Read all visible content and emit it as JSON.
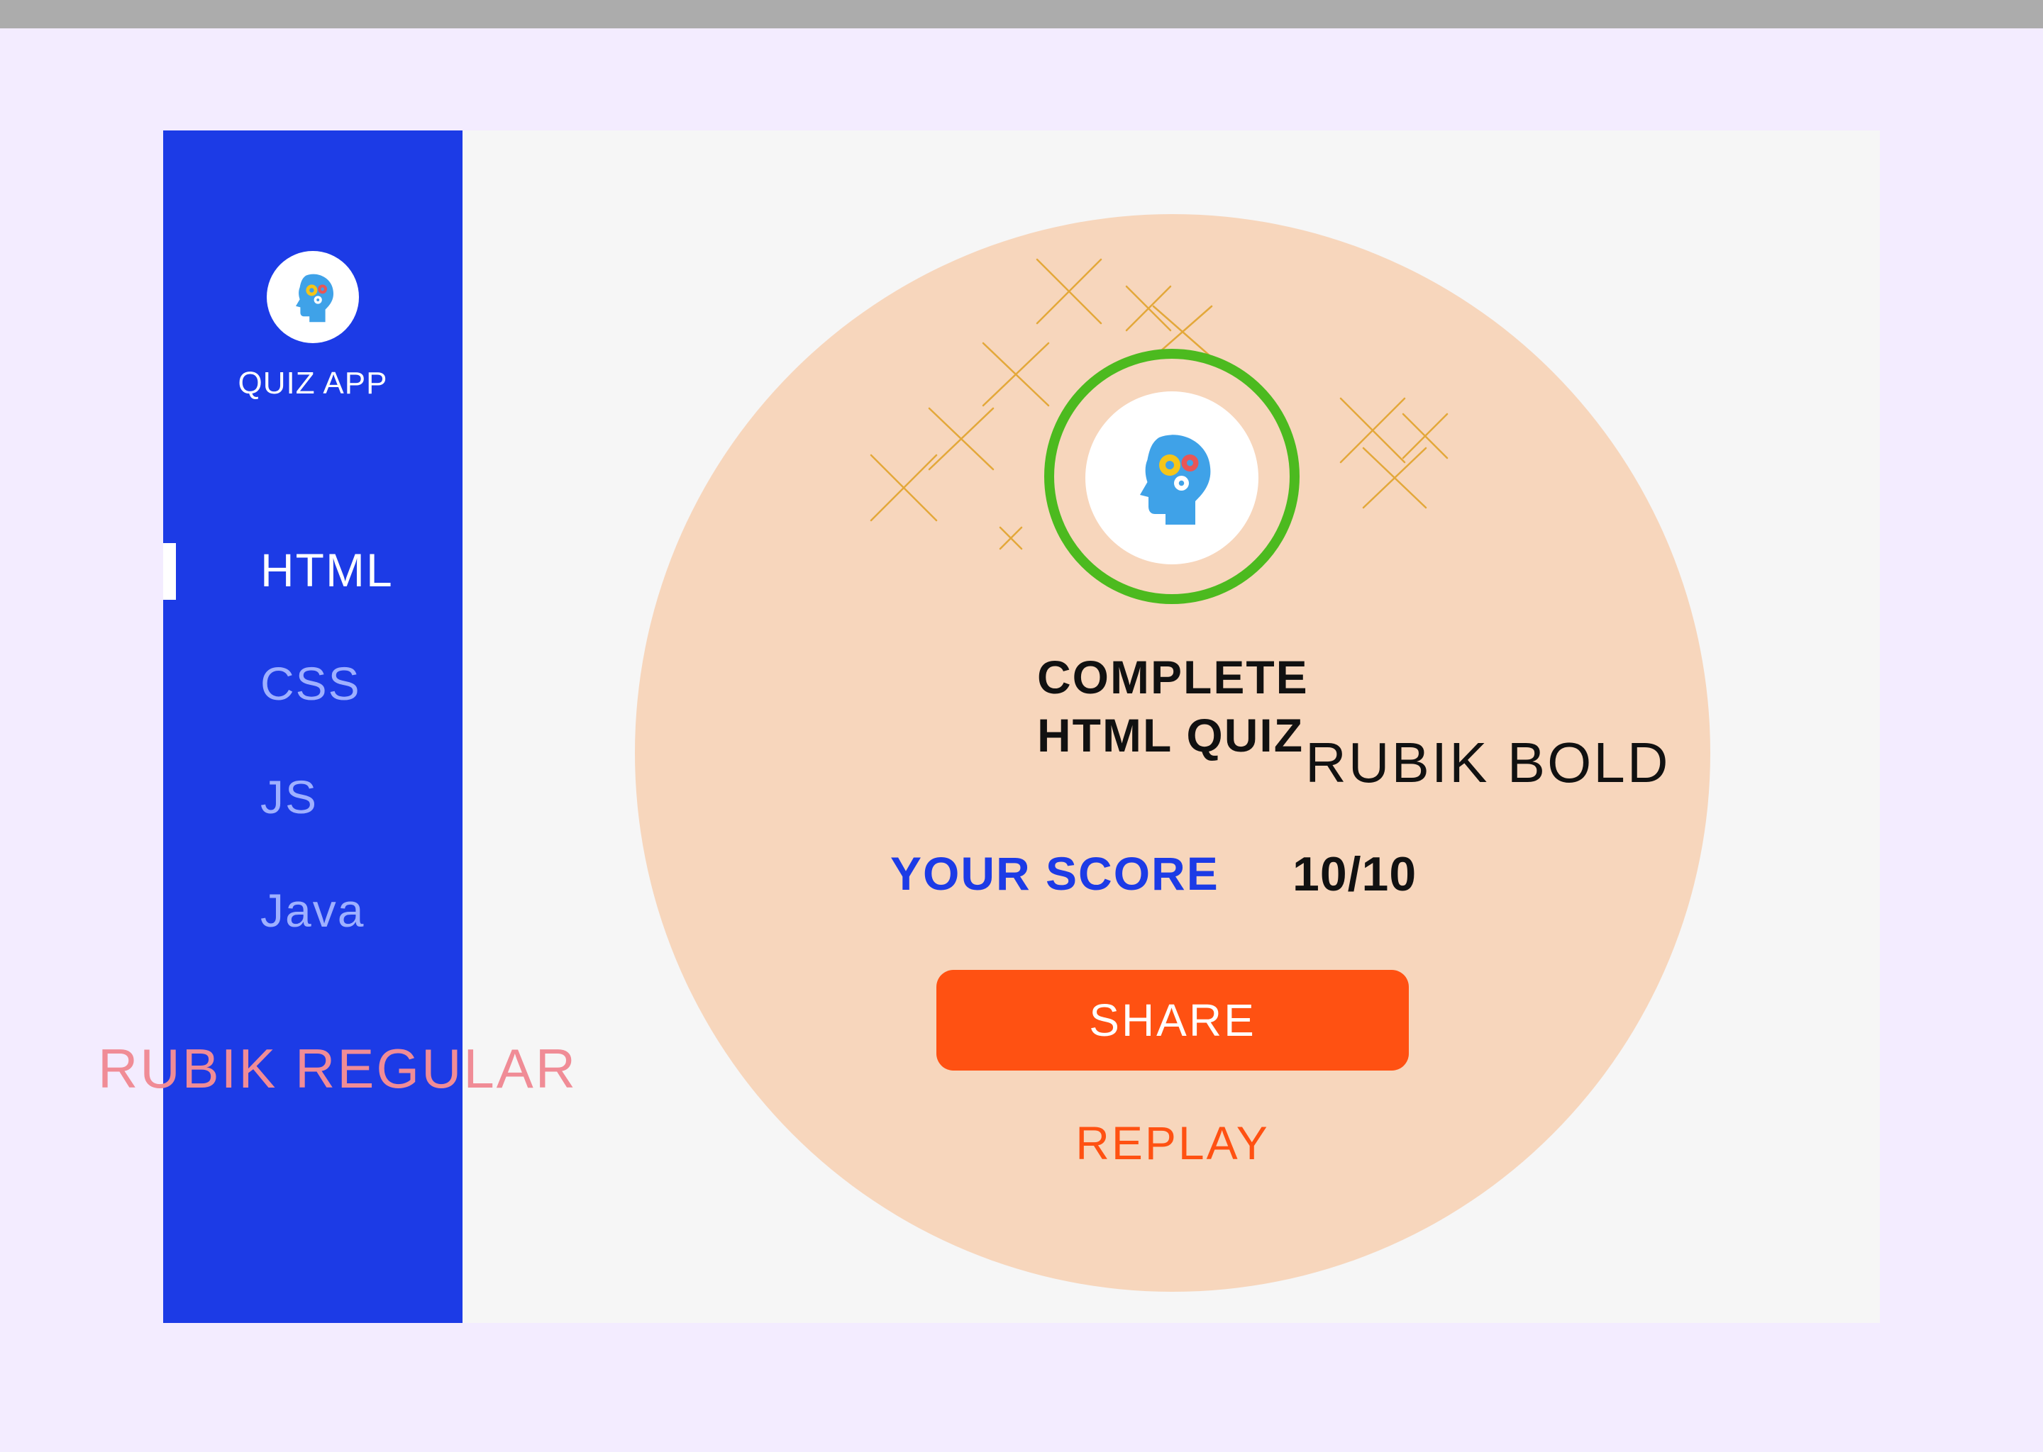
{
  "sidebar": {
    "app_name": "QUIZ APP",
    "logo_icon": "brain-gears-icon",
    "items": [
      {
        "label": "HTML",
        "active": true
      },
      {
        "label": "CSS",
        "active": false
      },
      {
        "label": "JS",
        "active": false
      },
      {
        "label": "Java",
        "active": false
      }
    ]
  },
  "result": {
    "title_line1": "COMPLETE",
    "title_line2": "HTML QUIZ",
    "score_label": "YOUR SCORE",
    "score_value": "10/10",
    "badge_icon": "brain-gears-icon",
    "share_label": "SHARE",
    "replay_label": "REPLAY"
  },
  "annotations": {
    "regular_font_note": "RUBIK REGULAR",
    "bold_font_note": "RUBIK BOLD"
  },
  "colors": {
    "primary_blue": "#1c3be6",
    "accent_orange": "#ff5112",
    "success_green": "#4cba1f",
    "circle_peach": "#f7d6bc",
    "page_background": "#f3ecff"
  }
}
